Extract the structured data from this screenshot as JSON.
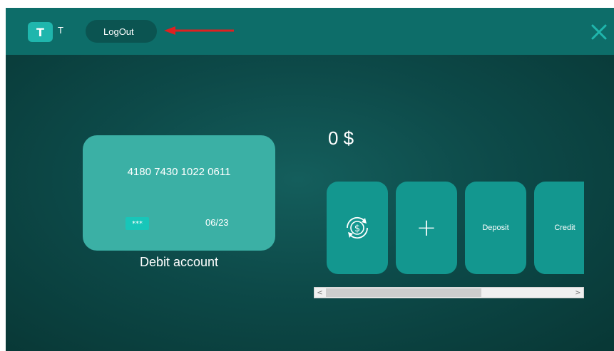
{
  "header": {
    "logo_letter": "T",
    "user_initial": "T",
    "logout_label": "LogOut"
  },
  "card": {
    "number": "4180 7430 1022 0611",
    "cvv_mask": "***",
    "expiry": "06/23",
    "label": "Debit account"
  },
  "balance": {
    "text": "0 $"
  },
  "actions": [
    {
      "icon": "currency-exchange-icon"
    },
    {
      "icon": "plus-icon",
      "glyph": "+"
    },
    {
      "label": "Deposit"
    },
    {
      "label": "Credit"
    }
  ],
  "scrollbar": {
    "left_arrow": "<",
    "right_arrow": ">"
  },
  "colors": {
    "titlebar": "#0d6d69",
    "background": "#0d4a49",
    "card": "#3bb0a5",
    "tile": "#13978f",
    "accent": "#1fb6ad",
    "annotation_arrow": "#e02020"
  }
}
